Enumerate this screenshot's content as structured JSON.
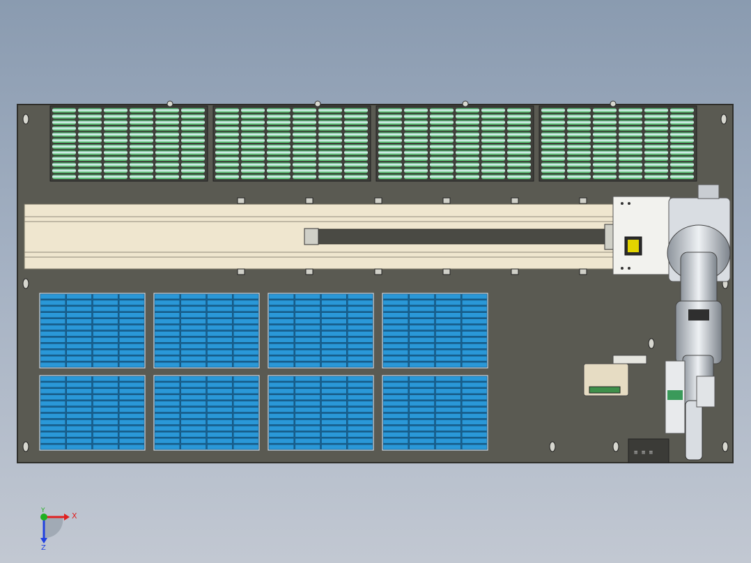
{
  "viewport": {
    "background_top": "#8a9bb0",
    "background_bottom": "#c2c8d2",
    "plate_color": "#5a5a52",
    "plate_edge": "#2e2e2a"
  },
  "green_racks": {
    "color": "#2fae4a",
    "highlight": "#e8f5ff",
    "groups": 4,
    "columns_per_group": 6,
    "rows": 12
  },
  "blue_trays": {
    "color": "#2a98d8",
    "grid_rows": 2,
    "grid_cols": 4,
    "columns_per_tray": 4,
    "rows_per_tray": 12
  },
  "linear_rail": {
    "color": "#efe6cf",
    "slot_color": "#4a4a44",
    "carriage_marker": "#e2d400"
  },
  "robot_arm": {
    "body_color": "#d9dde2",
    "shade_color": "#8d949c"
  },
  "triad": {
    "x_label": "X",
    "y_label": "Y",
    "z_label": "Z",
    "x_color": "#e02020",
    "y_color": "#20b020",
    "z_color": "#2040e0"
  }
}
